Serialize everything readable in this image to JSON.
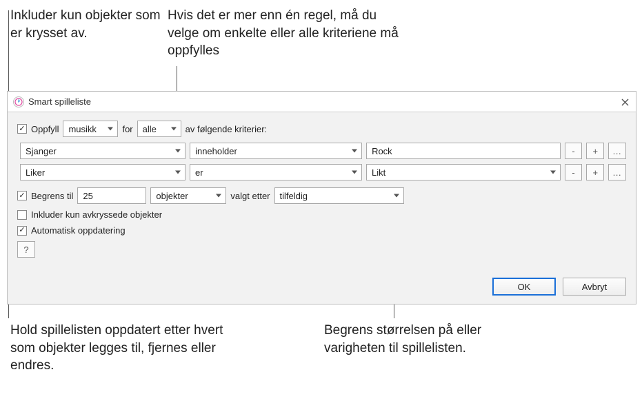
{
  "callouts": {
    "top_left": "Inkluder kun objekter som er krysset av.",
    "top_right": "Hvis det er mer enn én regel, må du velge om enkelte eller alle kriteriene må oppfylles",
    "bottom_left": "Hold spillelisten oppdatert etter hvert som objekter legges til, fjernes eller endres.",
    "bottom_right": "Begrens størrelsen på eller varigheten til spillelisten."
  },
  "dialog": {
    "title": "Smart spilleliste",
    "match": {
      "checkbox_checked": true,
      "label": "Oppfyll",
      "media": "musikk",
      "for_label": "for",
      "scope": "alle",
      "trailing": "av følgende kriterier:"
    },
    "rules": [
      {
        "field": "Sjanger",
        "op": "inneholder",
        "value": "Rock",
        "value_is_select": false
      },
      {
        "field": "Liker",
        "op": "er",
        "value": "Likt",
        "value_is_select": true
      }
    ],
    "limit": {
      "checked": true,
      "label": "Begrens til",
      "value": "25",
      "unit": "objekter",
      "mid_label": "valgt etter",
      "by": "tilfeldig"
    },
    "only_checked": {
      "checked": false,
      "label": "Inkluder kun avkryssede objekter"
    },
    "live_update": {
      "checked": true,
      "label": "Automatisk oppdatering"
    },
    "buttons": {
      "help": "?",
      "ok": "OK",
      "cancel": "Avbryt",
      "minus": "-",
      "plus": "+",
      "dots": "…"
    }
  }
}
